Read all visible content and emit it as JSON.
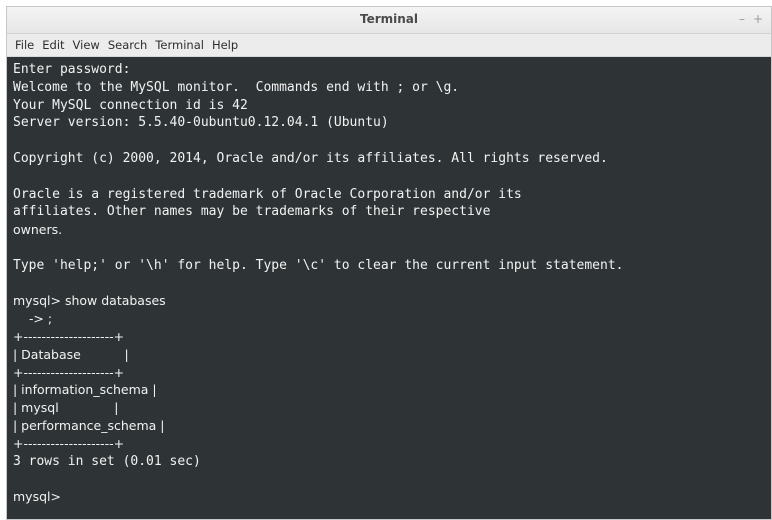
{
  "window": {
    "title": "Terminal",
    "minimize": "–",
    "close": "+"
  },
  "menu": [
    "File",
    "Edit",
    "View",
    "Search",
    "Terminal",
    "Help"
  ],
  "terminal": {
    "lines": [
      "Enter password:",
      "Welcome to the MySQL monitor.  Commands end with ; or \\g.",
      "Your MySQL connection id is 42",
      "Server version: 5.5.40-0ubuntu0.12.04.1 (Ubuntu)",
      "",
      "Copyright (c) 2000, 2014, Oracle and/or its affiliates. All rights reserved.",
      "",
      "Oracle is a registered trademark of Oracle Corporation and/or its",
      "affiliates. Other names may be trademarks of their respective",
      "owners.",
      "",
      "Type 'help;' or '\\h' for help. Type '\\c' to clear the current input statement.",
      "",
      "mysql> show databases",
      "    -> ;",
      "+--------------------+",
      "| Database           |",
      "+--------------------+",
      "| information_schema |",
      "| mysql              |",
      "| performance_schema |",
      "+--------------------+",
      "3 rows in set (0.01 sec)",
      "",
      "mysql>"
    ]
  }
}
